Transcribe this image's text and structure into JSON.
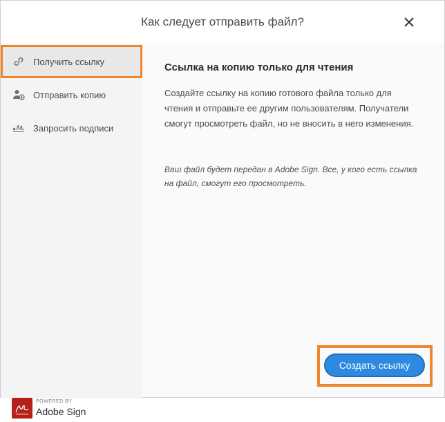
{
  "dialog": {
    "title": "Как следует отправить файл?",
    "close_icon": "close-icon"
  },
  "sidebar": {
    "items": [
      {
        "label": "Получить ссылку",
        "icon": "link-icon",
        "active": true
      },
      {
        "label": "Отправить копию",
        "icon": "add-person-icon",
        "active": false
      },
      {
        "label": "Запросить подписи",
        "icon": "signature-icon",
        "active": false
      }
    ]
  },
  "main": {
    "heading": "Ссылка на копию только для чтения",
    "description": "Создайте ссылку на копию готового файла только для чтения и отправьте ее другим пользователям. Получатели смогут просмотреть файл, но не вносить в него изменения.",
    "note": "Ваш файл будет передан в Adobe Sign. Все, у кого есть ссылка на файл, смогут его просмотреть."
  },
  "brand": {
    "powered_by": "POWERED BY",
    "name": "Adobe Sign",
    "icon": "adobe-sign-logo-icon"
  },
  "actions": {
    "create_link_label": "Создать ссылку"
  },
  "colors": {
    "accent": "#2d8ae0",
    "highlight": "#f0852c",
    "brand_red": "#b5201b"
  }
}
